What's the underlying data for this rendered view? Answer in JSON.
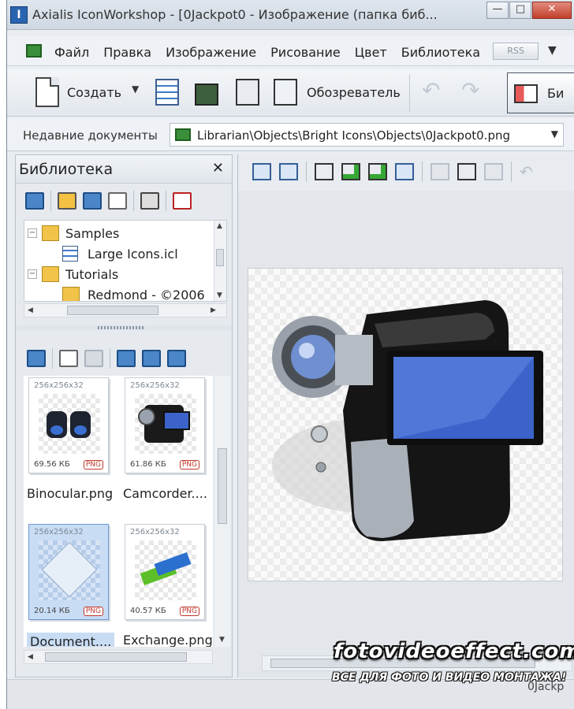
{
  "window": {
    "title": "Axialis IconWorkshop - [0Jackpot0 - Изображение (папка биб...",
    "buttons": {
      "minimize": "—",
      "maximize": "□",
      "close": "✕"
    }
  },
  "menu": {
    "items": [
      "Файл",
      "Правка",
      "Изображение",
      "Рисование",
      "Цвет",
      "Библиотека"
    ],
    "rss": "RSS"
  },
  "toolbar": {
    "create_label": "Создать",
    "browser_label": "Обозреватель",
    "library_label": "Би"
  },
  "recent": {
    "label": "Недавние документы",
    "path": "Librarian\\Objects\\Bright Icons\\Objects\\0Jackpot0.png"
  },
  "library": {
    "title": "Библиотека",
    "close": "✕",
    "tree": [
      {
        "label": "Samples",
        "type": "folder"
      },
      {
        "label": "Large Icons.icl",
        "type": "file"
      },
      {
        "label": "Tutorials",
        "type": "folder"
      },
      {
        "label": "Redmond - ©2006",
        "type": "folder"
      }
    ],
    "thumbnails": [
      {
        "name": "Binocular.png",
        "dims": "256x256x32",
        "size": "69.56 КБ",
        "format": "PNG",
        "icon": "binocular-icon",
        "selected": false
      },
      {
        "name": "Camcorder....",
        "dims": "256x256x32",
        "size": "61.86 КБ",
        "format": "PNG",
        "icon": "camcorder-icon",
        "selected": false
      },
      {
        "name": "Document....",
        "dims": "256x256x32",
        "size": "20.14 КБ",
        "format": "PNG",
        "icon": "document-icon",
        "selected": true
      },
      {
        "name": "Exchange.png",
        "dims": "256x256x32",
        "size": "40.57 КБ",
        "format": "PNG",
        "icon": "exchange-icon",
        "selected": false
      }
    ]
  },
  "status": {
    "text": "0Jackp"
  },
  "watermark": {
    "site": "fotovideoeffect.com",
    "tagline": "ВСЕ ДЛЯ ФОТО И ВИДЕО МОНТАЖА!"
  },
  "colors": {
    "accent": "#2a64b0",
    "selection": "#c8dcf4",
    "screen_blue": "#3b63c9"
  }
}
